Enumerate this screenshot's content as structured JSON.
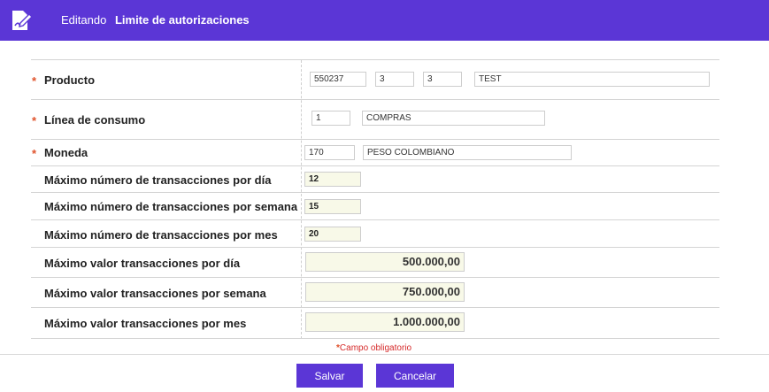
{
  "header": {
    "prefix": "Editando",
    "title": "Limite de autorizaciones",
    "icon": "edit-document-icon"
  },
  "colors": {
    "accent": "#5b36d6",
    "required": "#e0522b"
  },
  "required_mark": "*",
  "form": {
    "producto": {
      "label": "Producto",
      "code": "550237",
      "sub1": "3",
      "sub2": "3",
      "name": "TEST"
    },
    "linea": {
      "label": "Línea de consumo",
      "code": "1",
      "name": "COMPRAS"
    },
    "moneda": {
      "label": "Moneda",
      "code": "170",
      "name": "PESO COLOMBIANO"
    },
    "max_tx_dia": {
      "label": "Máximo número de transacciones por día",
      "value": "12"
    },
    "max_tx_semana": {
      "label": "Máximo número de transacciones por semana",
      "value": "15"
    },
    "max_tx_mes": {
      "label": "Máximo número de transacciones por mes",
      "value": "20"
    },
    "max_val_dia": {
      "label": "Máximo valor transacciones por día",
      "value": "500.000,00"
    },
    "max_val_semana": {
      "label": "Máximo valor transacciones por semana",
      "value": "750.000,00"
    },
    "max_val_mes": {
      "label": "Máximo valor transacciones por mes",
      "value": "1.000.000,00"
    }
  },
  "required_note": "Campo obligatorio",
  "buttons": {
    "save": "Salvar",
    "cancel": "Cancelar"
  }
}
